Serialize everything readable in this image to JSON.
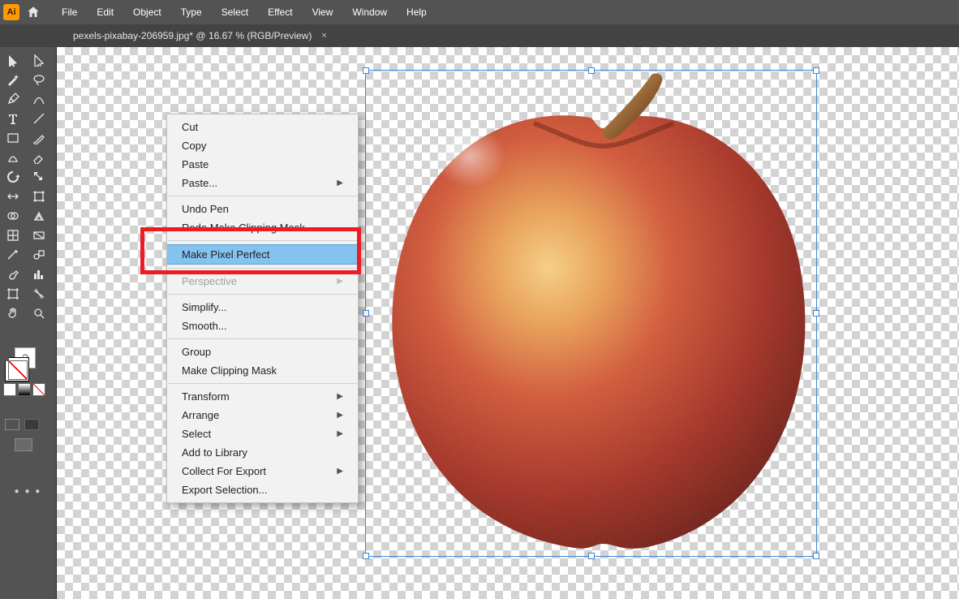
{
  "app": {
    "logo_text": "Ai"
  },
  "menu": {
    "file": "File",
    "edit": "Edit",
    "object": "Object",
    "type": "Type",
    "select": "Select",
    "effect": "Effect",
    "view": "View",
    "window": "Window",
    "help": "Help"
  },
  "tab": {
    "title": "pexels-pixabay-206959.jpg* @ 16.67 % (RGB/Preview)",
    "close": "×"
  },
  "context_menu": {
    "cut": "Cut",
    "copy": "Copy",
    "paste": "Paste",
    "paste_sub": "Paste...",
    "undo": "Undo Pen",
    "redo": "Redo Make Clipping Mask",
    "pixel_perfect": "Make Pixel Perfect",
    "perspective": "Perspective",
    "simplify": "Simplify...",
    "smooth": "Smooth...",
    "group": "Group",
    "clip": "Make Clipping Mask",
    "transform": "Transform",
    "arrange": "Arrange",
    "select": "Select",
    "library": "Add to Library",
    "collect": "Collect For Export",
    "export_sel": "Export Selection..."
  },
  "tool_names": [
    "selection",
    "direct-selection",
    "magic-wand",
    "lasso",
    "pen",
    "curvature-pen",
    "type",
    "line",
    "rectangle",
    "paintbrush",
    "shaper",
    "eraser",
    "rotate",
    "scale",
    "width",
    "free-transform",
    "shape-builder",
    "perspective-grid",
    "mesh",
    "gradient",
    "eyedropper",
    "blend",
    "symbol-sprayer",
    "column-graph",
    "artboard",
    "slice",
    "hand",
    "zoom"
  ],
  "swatch": {
    "question": "?"
  }
}
